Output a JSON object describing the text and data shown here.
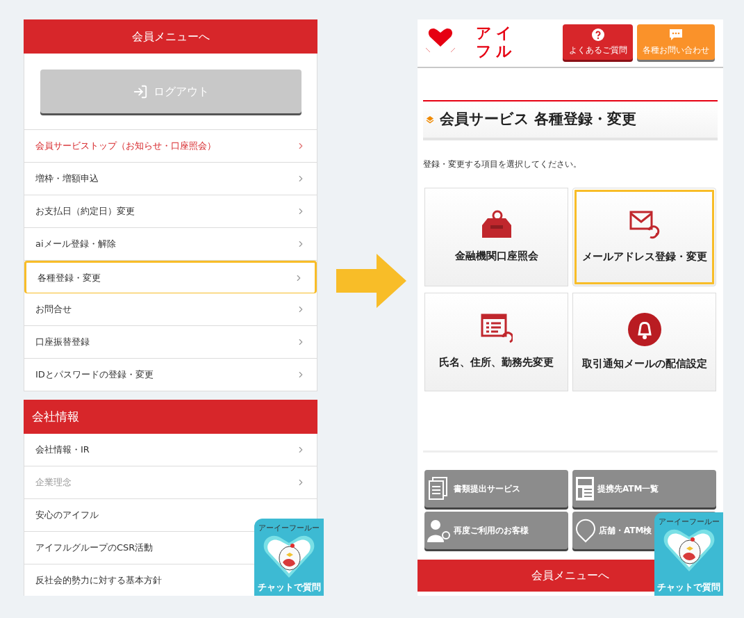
{
  "left_screen": {
    "menu_header": "会員メニューへ",
    "logout_button": "ログアウト",
    "menu_items": [
      {
        "label": "会員サービストップ（お知らせ・口座照会）",
        "kind": "accent",
        "selected": false,
        "chevron": true
      },
      {
        "label": "増枠・増額申込",
        "kind": "normal",
        "selected": false,
        "chevron": true
      },
      {
        "label": "お支払日（約定日）変更",
        "kind": "normal",
        "selected": false,
        "chevron": true
      },
      {
        "label": "aiメール登録・解除",
        "kind": "normal",
        "selected": false,
        "chevron": true
      },
      {
        "label": "各種登録・変更",
        "kind": "normal",
        "selected": true,
        "chevron": true
      },
      {
        "label": "お問合せ",
        "kind": "normal",
        "selected": false,
        "chevron": true
      },
      {
        "label": "口座振替登録",
        "kind": "normal",
        "selected": false,
        "chevron": true
      },
      {
        "label": "IDとパスワードの登録・変更",
        "kind": "normal",
        "selected": false,
        "chevron": true
      }
    ],
    "section_header": "会社情報",
    "company_items": [
      {
        "label": "会社情報・IR",
        "kind": "normal",
        "chevron": true
      },
      {
        "label": "企業理念",
        "kind": "muted",
        "chevron": true
      },
      {
        "label": "安心のアイフル",
        "kind": "normal",
        "chevron": false
      },
      {
        "label": "アイフルグループのCSR活動",
        "kind": "normal"
      },
      {
        "label": "反社会的勢力に対する基本方針",
        "kind": "normal"
      }
    ],
    "chat_badge": {
      "caption": "アーイーフールー",
      "label": "チャットで質問"
    }
  },
  "right_screen": {
    "logo": [
      "アイ",
      "フル"
    ],
    "header_buttons": [
      {
        "label": "よくあるご質問",
        "kind": "faq"
      },
      {
        "label": "各種お問い合わせ",
        "kind": "contact"
      }
    ],
    "page_title": "会員サービス 各種登録・変更",
    "instruction": "登録・変更する項目を選択してください。",
    "tiles": [
      {
        "label": "金融機関口座照会",
        "kind": "account",
        "selected": false
      },
      {
        "label": "メールアドレス登録・変更",
        "kind": "mail",
        "selected": true
      },
      {
        "label": "氏名、住所、勤務先変更",
        "kind": "form",
        "selected": false
      },
      {
        "label": "取引通知メールの配信設定",
        "kind": "bell",
        "selected": false
      }
    ],
    "links": [
      {
        "label": "書類提出サービス",
        "kind": "documents"
      },
      {
        "label": "提携先ATM一覧",
        "kind": "atm"
      },
      {
        "label": "再度ご利用のお客様",
        "kind": "returning"
      },
      {
        "label": "店舗・ATM検",
        "kind": "pin"
      }
    ],
    "bottom_button": "会員メニューへ",
    "chat_badge": {
      "caption": "アーイーフールー",
      "label": "チャットで質問"
    }
  }
}
